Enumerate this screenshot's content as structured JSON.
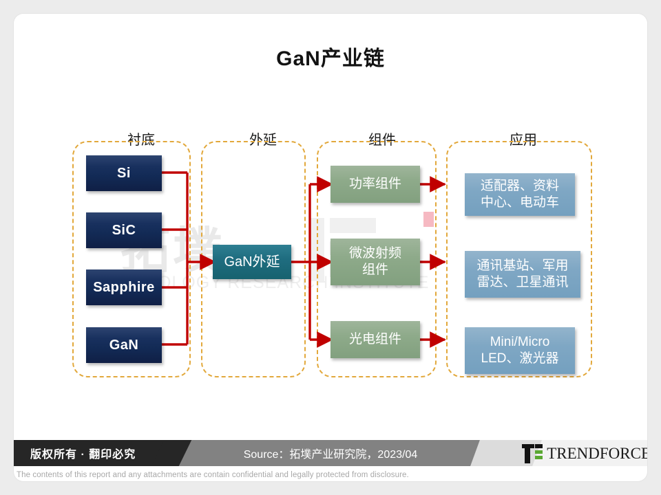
{
  "title": "GaN产业链",
  "watermark": {
    "cn": "拓墣",
    "en": "TOPOLOGY RESEARCH INSTITUTE"
  },
  "columns": [
    {
      "header": "衬底"
    },
    {
      "header": "外延"
    },
    {
      "header": "组件"
    },
    {
      "header": "应用"
    }
  ],
  "substrate_nodes": [
    {
      "label": "Si"
    },
    {
      "label": "SiC"
    },
    {
      "label": "Sapphire"
    },
    {
      "label": "GaN"
    }
  ],
  "epitaxy_nodes": [
    {
      "label": "GaN外延"
    }
  ],
  "component_nodes": [
    {
      "label": "功率组件"
    },
    {
      "label": "微波射频\n组件"
    },
    {
      "label": "光电组件"
    }
  ],
  "application_nodes": [
    {
      "label": "适配器、资料\n中心、电动车"
    },
    {
      "label": "通讯基站、军用\n雷达、卫星通讯"
    },
    {
      "label": "Mini/Micro\nLED、激光器"
    }
  ],
  "colors": {
    "substrate": "#17305d",
    "epitaxy": "#1f6d80",
    "component": "#8eaa8a",
    "application": "#7fa7c4",
    "connector": "#c00000",
    "group_border": "#e2a83b",
    "artifact": "#f6b9c2"
  },
  "footer": {
    "copyright": "版权所有 · 翻印必究",
    "source": "Source：拓墣产业研究院，2023/04",
    "brand": "TRENDFORCE",
    "disclaimer": "The contents of this report and any attachments are contain confidential and legally protected from disclosure."
  }
}
